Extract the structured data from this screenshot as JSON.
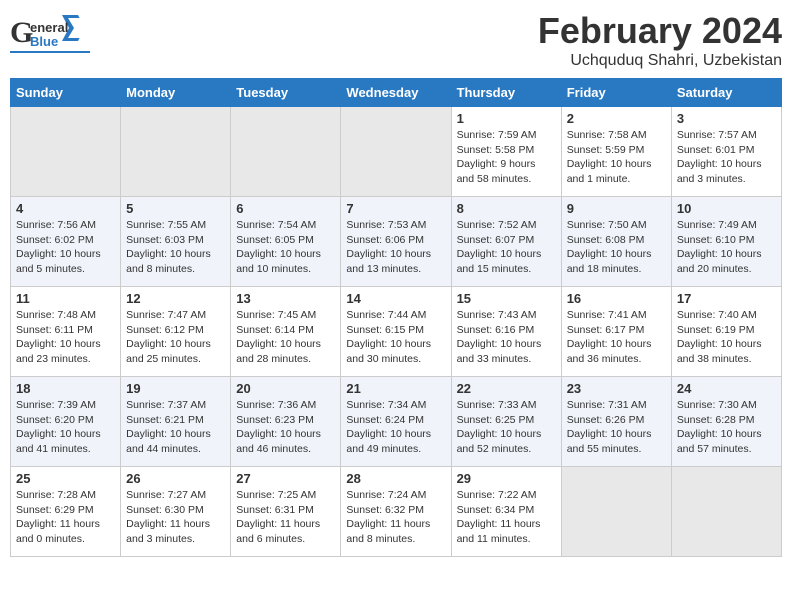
{
  "header": {
    "logo_general": "General",
    "logo_blue": "Blue",
    "month_title": "February 2024",
    "location": "Uchquduq Shahri, Uzbekistan"
  },
  "days_of_week": [
    "Sunday",
    "Monday",
    "Tuesday",
    "Wednesday",
    "Thursday",
    "Friday",
    "Saturday"
  ],
  "weeks": [
    {
      "cells": [
        {
          "day": "",
          "info": ""
        },
        {
          "day": "",
          "info": ""
        },
        {
          "day": "",
          "info": ""
        },
        {
          "day": "",
          "info": ""
        },
        {
          "day": "1",
          "info": "Sunrise: 7:59 AM\nSunset: 5:58 PM\nDaylight: 9 hours and 58 minutes."
        },
        {
          "day": "2",
          "info": "Sunrise: 7:58 AM\nSunset: 5:59 PM\nDaylight: 10 hours and 1 minute."
        },
        {
          "day": "3",
          "info": "Sunrise: 7:57 AM\nSunset: 6:01 PM\nDaylight: 10 hours and 3 minutes."
        }
      ]
    },
    {
      "cells": [
        {
          "day": "4",
          "info": "Sunrise: 7:56 AM\nSunset: 6:02 PM\nDaylight: 10 hours and 5 minutes."
        },
        {
          "day": "5",
          "info": "Sunrise: 7:55 AM\nSunset: 6:03 PM\nDaylight: 10 hours and 8 minutes."
        },
        {
          "day": "6",
          "info": "Sunrise: 7:54 AM\nSunset: 6:05 PM\nDaylight: 10 hours and 10 minutes."
        },
        {
          "day": "7",
          "info": "Sunrise: 7:53 AM\nSunset: 6:06 PM\nDaylight: 10 hours and 13 minutes."
        },
        {
          "day": "8",
          "info": "Sunrise: 7:52 AM\nSunset: 6:07 PM\nDaylight: 10 hours and 15 minutes."
        },
        {
          "day": "9",
          "info": "Sunrise: 7:50 AM\nSunset: 6:08 PM\nDaylight: 10 hours and 18 minutes."
        },
        {
          "day": "10",
          "info": "Sunrise: 7:49 AM\nSunset: 6:10 PM\nDaylight: 10 hours and 20 minutes."
        }
      ]
    },
    {
      "cells": [
        {
          "day": "11",
          "info": "Sunrise: 7:48 AM\nSunset: 6:11 PM\nDaylight: 10 hours and 23 minutes."
        },
        {
          "day": "12",
          "info": "Sunrise: 7:47 AM\nSunset: 6:12 PM\nDaylight: 10 hours and 25 minutes."
        },
        {
          "day": "13",
          "info": "Sunrise: 7:45 AM\nSunset: 6:14 PM\nDaylight: 10 hours and 28 minutes."
        },
        {
          "day": "14",
          "info": "Sunrise: 7:44 AM\nSunset: 6:15 PM\nDaylight: 10 hours and 30 minutes."
        },
        {
          "day": "15",
          "info": "Sunrise: 7:43 AM\nSunset: 6:16 PM\nDaylight: 10 hours and 33 minutes."
        },
        {
          "day": "16",
          "info": "Sunrise: 7:41 AM\nSunset: 6:17 PM\nDaylight: 10 hours and 36 minutes."
        },
        {
          "day": "17",
          "info": "Sunrise: 7:40 AM\nSunset: 6:19 PM\nDaylight: 10 hours and 38 minutes."
        }
      ]
    },
    {
      "cells": [
        {
          "day": "18",
          "info": "Sunrise: 7:39 AM\nSunset: 6:20 PM\nDaylight: 10 hours and 41 minutes."
        },
        {
          "day": "19",
          "info": "Sunrise: 7:37 AM\nSunset: 6:21 PM\nDaylight: 10 hours and 44 minutes."
        },
        {
          "day": "20",
          "info": "Sunrise: 7:36 AM\nSunset: 6:23 PM\nDaylight: 10 hours and 46 minutes."
        },
        {
          "day": "21",
          "info": "Sunrise: 7:34 AM\nSunset: 6:24 PM\nDaylight: 10 hours and 49 minutes."
        },
        {
          "day": "22",
          "info": "Sunrise: 7:33 AM\nSunset: 6:25 PM\nDaylight: 10 hours and 52 minutes."
        },
        {
          "day": "23",
          "info": "Sunrise: 7:31 AM\nSunset: 6:26 PM\nDaylight: 10 hours and 55 minutes."
        },
        {
          "day": "24",
          "info": "Sunrise: 7:30 AM\nSunset: 6:28 PM\nDaylight: 10 hours and 57 minutes."
        }
      ]
    },
    {
      "cells": [
        {
          "day": "25",
          "info": "Sunrise: 7:28 AM\nSunset: 6:29 PM\nDaylight: 11 hours and 0 minutes."
        },
        {
          "day": "26",
          "info": "Sunrise: 7:27 AM\nSunset: 6:30 PM\nDaylight: 11 hours and 3 minutes."
        },
        {
          "day": "27",
          "info": "Sunrise: 7:25 AM\nSunset: 6:31 PM\nDaylight: 11 hours and 6 minutes."
        },
        {
          "day": "28",
          "info": "Sunrise: 7:24 AM\nSunset: 6:32 PM\nDaylight: 11 hours and 8 minutes."
        },
        {
          "day": "29",
          "info": "Sunrise: 7:22 AM\nSunset: 6:34 PM\nDaylight: 11 hours and 11 minutes."
        },
        {
          "day": "",
          "info": ""
        },
        {
          "day": "",
          "info": ""
        }
      ]
    }
  ]
}
